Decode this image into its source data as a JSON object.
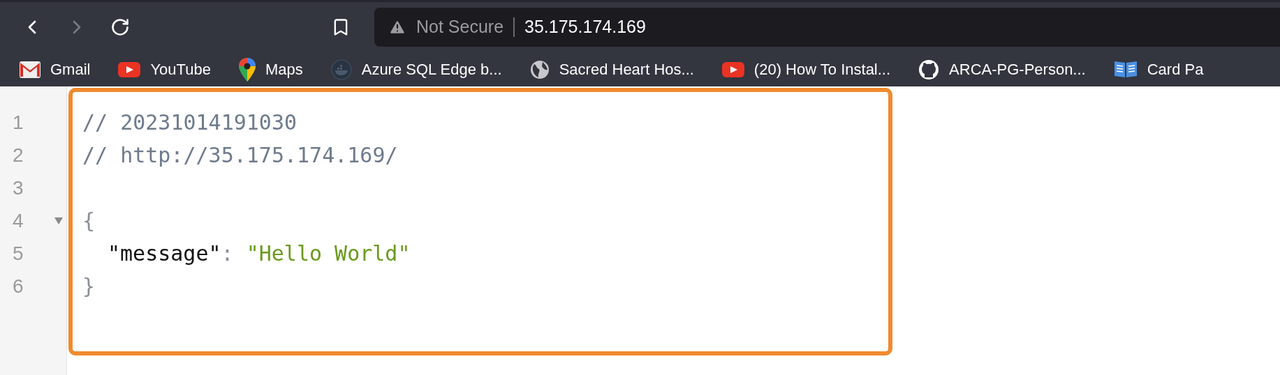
{
  "toolbar": {
    "back": {
      "disabled": false
    },
    "forward": {
      "disabled": true
    },
    "address_bar": {
      "security": "Not Secure",
      "url": "35.175.174.169"
    }
  },
  "bookmarks": [
    {
      "kind": "gmail",
      "label": "Gmail"
    },
    {
      "kind": "youtube",
      "label": "YouTube"
    },
    {
      "kind": "maps",
      "label": "Maps"
    },
    {
      "kind": "docker",
      "label": "Azure SQL Edge b..."
    },
    {
      "kind": "globe",
      "label": "Sacred Heart Hos..."
    },
    {
      "kind": "youtube",
      "label": "(20) How To Instal..."
    },
    {
      "kind": "github",
      "label": "ARCA-PG-Person..."
    },
    {
      "kind": "book",
      "label": "Card Pa"
    }
  ],
  "editor": {
    "lines": [
      {
        "number": "1",
        "fold_toggle": false,
        "tokens": [
          {
            "kind": "comment",
            "text": "// 20231014191030"
          }
        ]
      },
      {
        "number": "2",
        "fold_toggle": false,
        "tokens": [
          {
            "kind": "comment",
            "text": "// http://35.175.174.169/"
          }
        ]
      },
      {
        "number": "3",
        "fold_toggle": false
      },
      {
        "number": "4",
        "fold_toggle": true,
        "tokens": [
          {
            "kind": "punct",
            "text": "{"
          }
        ]
      },
      {
        "number": "5",
        "fold_toggle": false,
        "indent": true,
        "tokens": [
          {
            "kind": "key",
            "text": "\"message\""
          },
          {
            "kind": "punct",
            "text": ":"
          },
          {
            "kind": "string",
            "text": "\"Hello World\""
          }
        ]
      },
      {
        "number": "6",
        "fold_toggle": false,
        "tokens": [
          {
            "kind": "punct",
            "text": "}"
          }
        ]
      }
    ]
  }
}
